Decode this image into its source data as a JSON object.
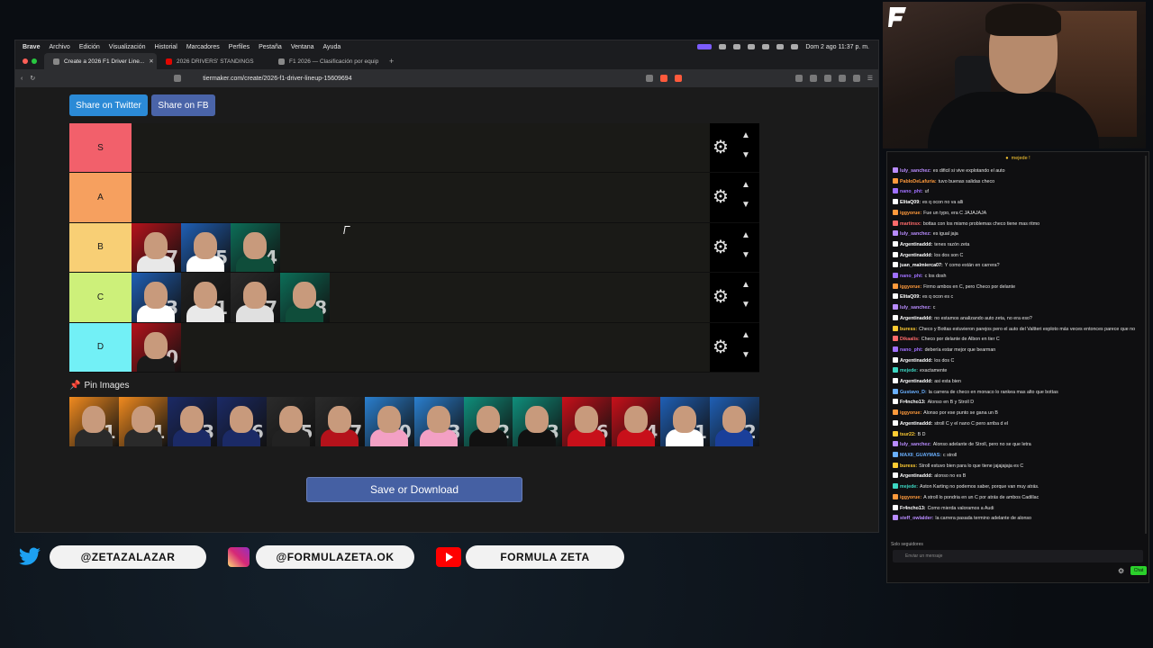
{
  "menubar": {
    "app": "Brave",
    "items": [
      "Archivo",
      "Edición",
      "Visualización",
      "Historial",
      "Marcadores",
      "Perfiles",
      "Pestaña",
      "Ventana",
      "Ayuda"
    ],
    "clock": "Dom 2 ago 11:37 p. m."
  },
  "tabs": [
    {
      "label": "Create a 2026 F1 Driver Line..."
    },
    {
      "label": "2026 DRIVERS' STANDINGS"
    },
    {
      "label": "F1 2026 — Clasificación por equip"
    }
  ],
  "address": {
    "url": "tiermaker.com/create/2026-f1-driver-lineup-15609694"
  },
  "share": {
    "twitter": "Share on Twitter",
    "fb": "Share on FB"
  },
  "tiers": [
    {
      "label": "S",
      "color": "#f2606b",
      "cards": []
    },
    {
      "label": "A",
      "color": "#f6a05f",
      "cards": []
    },
    {
      "label": "B",
      "color": "#f8cf75",
      "cards": [
        {
          "num": "87",
          "bg": "#b5121b",
          "suit": "#e8e8e8"
        },
        {
          "num": "55",
          "bg": "#1f5fb5",
          "suit": "#ffffff"
        },
        {
          "num": "14",
          "bg": "#0c6e58",
          "suit": "#0f4d3a"
        }
      ]
    },
    {
      "label": "C",
      "color": "#cdf07a",
      "cards": [
        {
          "num": "23",
          "bg": "#1f5fb5",
          "suit": "#ffffff"
        },
        {
          "num": "11",
          "bg": "#222222",
          "suit": "#e9e9e9"
        },
        {
          "num": "77",
          "bg": "#2a2a2a",
          "suit": "#e0e0e0"
        },
        {
          "num": "18",
          "bg": "#0c6e58",
          "suit": "#0f4d3a"
        }
      ]
    },
    {
      "label": "D",
      "color": "#72f0f6",
      "cards": [
        {
          "num": "30",
          "bg": "#b5121b",
          "suit": "#1a1a1a"
        }
      ]
    }
  ],
  "pin": {
    "label": "Pin Images"
  },
  "pool": [
    {
      "num": "1",
      "bg": "#f08a1f",
      "suit": "#2a2a2a"
    },
    {
      "num": "81",
      "bg": "#f08a1f",
      "suit": "#2a2a2a"
    },
    {
      "num": "3",
      "bg": "#1b2a66",
      "suit": "#1b2a66"
    },
    {
      "num": "6",
      "bg": "#1b2a66",
      "suit": "#1b2a66"
    },
    {
      "num": "5",
      "bg": "#2b2b2b",
      "suit": "#222222"
    },
    {
      "num": "27",
      "bg": "#2b2b2b",
      "suit": "#b5121b"
    },
    {
      "num": "10",
      "bg": "#2a7fcf",
      "suit": "#f3a0c4"
    },
    {
      "num": "43",
      "bg": "#2a7fcf",
      "suit": "#f3a0c4"
    },
    {
      "num": "12",
      "bg": "#0f8f7c",
      "suit": "#111111"
    },
    {
      "num": "63",
      "bg": "#0f8f7c",
      "suit": "#111111"
    },
    {
      "num": "16",
      "bg": "#c8101a",
      "suit": "#c8101a"
    },
    {
      "num": "44",
      "bg": "#c8101a",
      "suit": "#c8101a"
    },
    {
      "num": "31",
      "bg": "#1f5fb5",
      "suit": "#ffffff"
    },
    {
      "num": "22",
      "bg": "#1f5fb5",
      "suit": "#1a3f9a"
    }
  ],
  "save": {
    "label": "Save or Download"
  },
  "chat": {
    "header": "mejede !",
    "messages": [
      {
        "user": "luly_sanchez:",
        "color": "#b98cff",
        "text": "es dificil si vive explotando el auto"
      },
      {
        "user": "PabloDeLafuria:",
        "color": "#ff9a3c",
        "text": "tuvo buenas salidas checo"
      },
      {
        "user": "nano_pht:",
        "color": "#a070ff",
        "text": "uf"
      },
      {
        "user": "ElitaQ09:",
        "color": "#ffffff",
        "text": "es q ocon no va alli"
      },
      {
        "user": "iggyorue:",
        "color": "#ff9a3c",
        "text": "Fue un typo, era C JAJAJAJA"
      },
      {
        "user": "martinsx:",
        "color": "#ff6b6b",
        "text": "bottas con los mismo problemas checo tiene mas ritmo"
      },
      {
        "user": "luly_sanchez:",
        "color": "#b98cff",
        "text": "es igual jaja"
      },
      {
        "user": "Argentinaddd:",
        "color": "#ffffff",
        "text": "tenes razón zeta"
      },
      {
        "user": "Argentinaddd:",
        "color": "#ffffff",
        "text": "los dos son C"
      },
      {
        "user": "juan_malmierca07:",
        "color": "#ffffff",
        "text": "Y como están en carrera?"
      },
      {
        "user": "nano_pht:",
        "color": "#a070ff",
        "text": "c los dosh"
      },
      {
        "user": "iggyorue:",
        "color": "#ff9a3c",
        "text": "Firmo ambos en C, pero Checo por delante"
      },
      {
        "user": "ElitaQ09:",
        "color": "#ffffff",
        "text": "es q ocon es c"
      },
      {
        "user": "luly_sanchez:",
        "color": "#b98cff",
        "text": "c"
      },
      {
        "user": "Argentinaddd:",
        "color": "#ffffff",
        "text": "no estamos analizando auto zeta, no era eso?"
      },
      {
        "user": "buress:",
        "color": "#ffcc33",
        "text": "Checo y Bottas estuvieron parejos pero el auto del Valtteri exploto más veces entonces parece que no"
      },
      {
        "user": "Dikaalis:",
        "color": "#ff6b6b",
        "text": "Checo por delante de Albon en tier C"
      },
      {
        "user": "nano_pht:",
        "color": "#a070ff",
        "text": "debería estar mejor que bearman"
      },
      {
        "user": "Argentinaddd:",
        "color": "#ffffff",
        "text": "los dos C"
      },
      {
        "user": "mejede:",
        "color": "#3cd6c2",
        "text": "exactamente"
      },
      {
        "user": "Argentinaddd:",
        "color": "#ffffff",
        "text": "asi esta bien"
      },
      {
        "user": "Gustavo_D:",
        "color": "#6ab0ff",
        "text": "la carrera de checo en monaco lo rankea mas alto que bottas"
      },
      {
        "user": "Fr4ncho13:",
        "color": "#ffffff",
        "text": "Alonso en B y Stroll D"
      },
      {
        "user": "iggyorue:",
        "color": "#ff9a3c",
        "text": "Alonso por ese punto se gana un B"
      },
      {
        "user": "Argentinaddd:",
        "color": "#ffffff",
        "text": "stroll C y el nano C pero arriba d el"
      },
      {
        "user": "tsur22:",
        "color": "#ffcc33",
        "text": "B D"
      },
      {
        "user": "luly_sanchez:",
        "color": "#b98cff",
        "text": "Alonso adelante de Stroll, pero no se que letra"
      },
      {
        "user": "MAXII_GUAYMAS:",
        "color": "#6ab0ff",
        "text": "c stroll"
      },
      {
        "user": "buress:",
        "color": "#ffcc33",
        "text": "Stroll estuvo bien para lo que tiene jajajajaja es C"
      },
      {
        "user": "Argentinaddd:",
        "color": "#ffffff",
        "text": "alonso no es B"
      },
      {
        "user": "mejede:",
        "color": "#3cd6c2",
        "text": "Aston Karting no podemos saber, porque van muy atrás."
      },
      {
        "user": "iggyorue:",
        "color": "#ff9a3c",
        "text": "A stroll lo pondria en un C por atrás de ambos Cadillac"
      },
      {
        "user": "Fr4ncho13:",
        "color": "#ffffff",
        "text": "Como mierda valoramos a Audi"
      },
      {
        "user": "steff_owlalder:",
        "color": "#b98cff",
        "text": "la carrera pasada termino adelante de alonso"
      }
    ],
    "followers": "Solo seguidores",
    "input_placeholder": "Enviar un mensaje",
    "send": "Chat"
  },
  "socials": [
    {
      "name": "twitter",
      "handle": "@ZETAZALAZAR",
      "color": "#1da1f2"
    },
    {
      "name": "instagram",
      "handle": "@FORMULAZETA.OK",
      "color": "#d6249f"
    },
    {
      "name": "youtube",
      "handle": "FORMULA ZETA",
      "color": "#ff0000"
    }
  ]
}
